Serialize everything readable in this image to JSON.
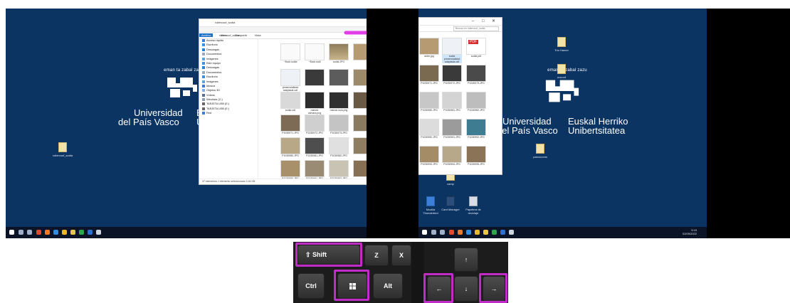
{
  "left_screen": {
    "logo": {
      "slogan": "eman ta zabal zazu",
      "line1": "Universidad",
      "line2": "del País Vasco",
      "partial1": "Eu",
      "partial2": "Un"
    },
    "desktop_icon_label": "rollercoof_sodia",
    "explorer": {
      "title": "rollercoof_sodia",
      "ribbon_tabs": [
        "Archivo",
        "Inicio",
        "Compartir",
        "Vista"
      ],
      "address": "rollercoof_sodia",
      "nav_items": [
        "Acceso rápido",
        "Escritorio",
        "Descargas",
        "Documentos",
        "Imágenes",
        "Este equipo",
        "Descargas",
        "Documentos",
        "Escritorio",
        "Imágenes",
        "Música",
        "Objetos 3D",
        "Vídeos",
        "Windows (C:)",
        "TARJETA USB (E:)",
        "TARJETA USB (E:)",
        "Red"
      ],
      "thumbs": [
        "~$ock.sodia",
        "~$ock.sodi",
        "sodia.JPG",
        "",
        "presencialidad adaptada.odt",
        "",
        "",
        "",
        "sodia.odt",
        "mando camara.png",
        "mando lock.png",
        "",
        "P1030971.JPG",
        "P1030972.JPG",
        "P1030973.JPG",
        "",
        "P1030980.JPG",
        "P1030981.JPG",
        "P1030982.JPG",
        "",
        "P1030990.JPG",
        "P1030991.JPG",
        "P1030992.JPG",
        ""
      ],
      "status": "37 elementos    1 elemento seleccionado  3,44 KB"
    }
  },
  "right_screen": {
    "logo": {
      "slogan": "eman ta zabal zazu",
      "l1a": "Universidad",
      "l1b": "del País Vasco",
      "l2a": "Euskal Herriko",
      "l2b": "Unibertsitatea"
    },
    "desktop_icons": [
      "Trio Hamer",
      "unconf",
      "parcocoms",
      "Mozilla Thunderbird",
      "Card Manager",
      "Papelera de reciclaje",
      "camp"
    ],
    "explorer": {
      "search_placeholder": "Buscar en rollercoof_sodia",
      "thumbs": [
        "anter.jpg",
        "sodia presencialidad adaptada.odt",
        "sodia.pdf",
        "",
        "P1030971.JPG",
        "P1030972.JPG",
        "P1030973.JPG",
        "P1030980.JPG",
        "P1030981.JPG",
        "P1030982.JPG",
        "P1030990.JPG",
        "P1030991.JPG",
        "P1030992.JPG",
        "P1030993.JPG",
        "P1030994.JPG",
        "P1030995.JPG"
      ],
      "pdf_badge": "PDF"
    },
    "clock": {
      "time": "9:15",
      "date": "02/09/2022"
    }
  },
  "keyboard": {
    "shift": "⇧ Shift",
    "z": "Z",
    "x": "X",
    "ctrl": "Ctrl",
    "alt": "Alt",
    "up": "↑",
    "down": "↓",
    "left": "←",
    "right": "→"
  },
  "colors": {
    "desktop": "#0c3463",
    "highlight": "#c12bc8",
    "arrow": "#e23ce6"
  }
}
